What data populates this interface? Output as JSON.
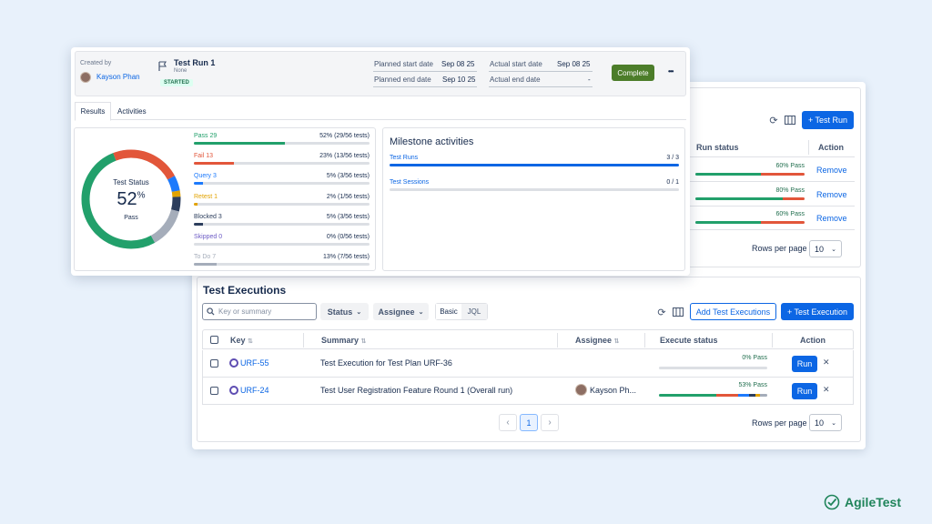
{
  "run_header": {
    "created_by_label": "Created by",
    "creator_name": "Kayson Phan",
    "title": "Test Run 1",
    "subtitle": "None",
    "status_badge": "STARTED",
    "planned_start_label": "Planned start date",
    "planned_start_value": "Sep 08 25",
    "planned_end_label": "Planned end date",
    "planned_end_value": "Sep 10 25",
    "actual_start_label": "Actual start date",
    "actual_start_value": "Sep 08 25",
    "actual_end_label": "Actual end date",
    "actual_end_value": "-",
    "complete_label": "Complete",
    "more_label": "•••"
  },
  "tabs": [
    {
      "label": "Results",
      "active": true
    },
    {
      "label": "Activities",
      "active": false
    }
  ],
  "donut": {
    "title": "Test Status",
    "value": "52",
    "unit": "%",
    "caption": "Pass"
  },
  "stats": [
    {
      "name": "Pass 29",
      "value": "52% (29/56 tests)",
      "fraction": 0.52,
      "color": "#22a06b"
    },
    {
      "name": "Fail 13",
      "value": "23% (13/56 tests)",
      "fraction": 0.23,
      "color": "#e2563a"
    },
    {
      "name": "Query 3",
      "value": "5% (3/56 tests)",
      "fraction": 0.05,
      "color": "#1d7afc"
    },
    {
      "name": "Retest 1",
      "value": "2% (1/56 tests)",
      "fraction": 0.02,
      "color": "#e2a300"
    },
    {
      "name": "Blocked 3",
      "value": "5% (3/56 tests)",
      "fraction": 0.05,
      "color": "#2c3e5d"
    },
    {
      "name": "Skipped 0",
      "value": "0% (0/56 tests)",
      "fraction": 0.0,
      "color": "#6e5dc6"
    },
    {
      "name": "To Do 7",
      "value": "13% (7/56 tests)",
      "fraction": 0.13,
      "color": "#a5adba"
    }
  ],
  "milestone": {
    "title": "Milestone activities",
    "items": [
      {
        "name": "Test Runs",
        "count": "3 / 3",
        "fraction": 1.0
      },
      {
        "name": "Test Sessions",
        "count": "0 / 1",
        "fraction": 0.0
      }
    ]
  },
  "runs_panel": {
    "add_button": "+ Test Run",
    "col_status": "Run status",
    "col_action": "Action",
    "rows": [
      {
        "pct_label": "60% Pass",
        "pass": 0.6,
        "fail": 0.4,
        "action": "Remove"
      },
      {
        "pct_label": "80% Pass",
        "pass": 0.8,
        "fail": 0.2,
        "action": "Remove"
      },
      {
        "pct_label": "60% Pass",
        "pass": 0.6,
        "fail": 0.4,
        "action": "Remove"
      }
    ],
    "rows_per_page_label": "Rows per page",
    "rows_per_page_value": "10"
  },
  "executions": {
    "title": "Test Executions",
    "search_placeholder": "Key or summary",
    "status_filter": "Status",
    "assignee_filter": "Assignee",
    "mode_basic": "Basic",
    "mode_jql": "JQL",
    "add_button": "Add Test Executions",
    "new_button": "+ Test Execution",
    "columns": {
      "key": "Key",
      "summary": "Summary",
      "assignee": "Assignee",
      "execute_status": "Execute status",
      "action": "Action"
    },
    "rows": [
      {
        "key": "URF-55",
        "summary": "Test Execution for Test Plan URF-36",
        "assignee": "",
        "pct_label": "0% Pass",
        "segments": [],
        "run_label": "Run",
        "remove_label": "✕"
      },
      {
        "key": "URF-24",
        "summary": "Test User Registration Feature Round 1 (Overall run)",
        "assignee": "Kayson Ph...",
        "pct_label": "53% Pass",
        "segments": [
          {
            "f": 0.53,
            "c": "#22a06b"
          },
          {
            "f": 0.2,
            "c": "#e2563a"
          },
          {
            "f": 0.1,
            "c": "#1d7afc"
          },
          {
            "f": 0.06,
            "c": "#2c3e5d"
          },
          {
            "f": 0.04,
            "c": "#e2a300"
          },
          {
            "f": 0.07,
            "c": "#a5adba"
          }
        ],
        "run_label": "Run",
        "remove_label": "✕"
      }
    ],
    "pagination": {
      "prev": "‹",
      "page": "1",
      "next": "›"
    },
    "rows_per_page_label": "Rows per page",
    "rows_per_page_value": "10"
  },
  "brand": {
    "name": "AgileTest",
    "color": "#1f845a"
  }
}
